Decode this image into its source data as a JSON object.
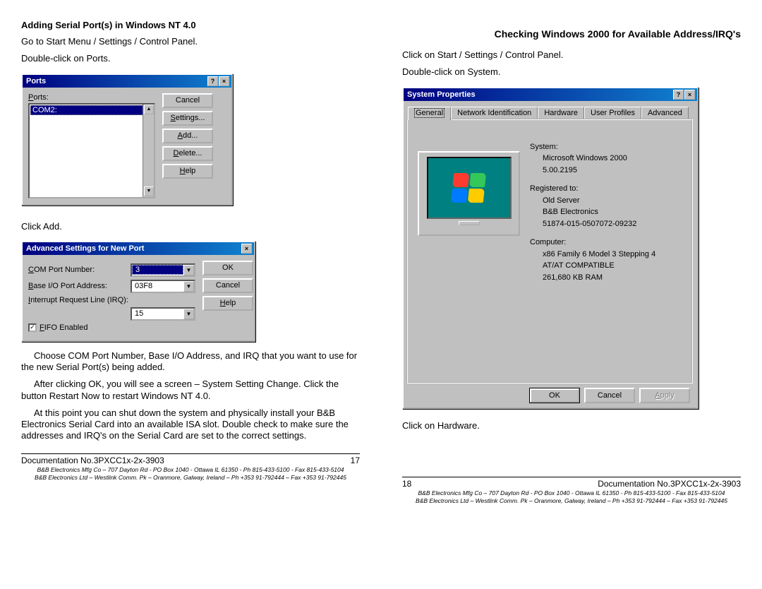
{
  "left": {
    "heading": "Adding Serial Port(s) in Windows NT 4.0",
    "step1": "Go to Start Menu / Settings / Control Panel.",
    "step2": "Double-click on Ports.",
    "step_clickadd": "Click Add.",
    "para1": "Choose COM Port Number, Base I/O Address, and IRQ that you want to use for the new Serial Port(s) being added.",
    "para2": "After clicking OK, you will see a screen – System Setting Change. Click the button Restart Now to restart Windows NT 4.0.",
    "para3": "At this point you can shut down the system and physically install your B&B Electronics Serial Card into an available ISA slot. Double check to make sure the addresses and IRQ's on the Serial Card are set to the correct settings.",
    "ports_window": {
      "title": "Ports",
      "label": "Ports:",
      "selected": "COM2:",
      "btn_cancel": "Cancel",
      "btn_settings": "Settings...",
      "btn_add": "Add...",
      "btn_delete": "Delete...",
      "btn_help": "Help"
    },
    "adv_window": {
      "title": "Advanced Settings for New Port",
      "lbl_com": "COM Port Number:",
      "val_com": "3",
      "lbl_base": "Base I/O Port Address:",
      "val_base": "03F8",
      "lbl_irq": "Interrupt Request Line (IRQ):",
      "val_irq": "15",
      "lbl_fifo": "FIFO Enabled",
      "btn_ok": "OK",
      "btn_cancel": "Cancel",
      "btn_help": "Help"
    },
    "footer": {
      "doc": "Documentation No.3PXCC1x-2x-3903",
      "page": "17",
      "line1": "B&B Electronics Mfg Co – 707 Dayton Rd - PO Box 1040 - Ottawa IL 61350 - Ph 815-433-5100 - Fax 815-433-5104",
      "line2": "B&B Electronics Ltd – Westlink Comm. Pk – Oranmore, Galway, Ireland – Ph +353 91-792444 – Fax +353 91-792445"
    }
  },
  "right": {
    "heading": "Checking Windows 2000 for Available Address/IRQ's",
    "step1": "Click on Start / Settings / Control Panel.",
    "step2": "Double-click on System.",
    "step3": "Click on Hardware.",
    "sys_window": {
      "title": "System Properties",
      "tabs": {
        "general": "General",
        "netid": "Network Identification",
        "hardware": "Hardware",
        "user": "User Profiles",
        "advanced": "Advanced"
      },
      "system_hdr": "System:",
      "system_v1": "Microsoft Windows 2000",
      "system_v2": "5.00.2195",
      "reg_hdr": "Registered to:",
      "reg_v1": "Old Server",
      "reg_v2": "B&B Electronics",
      "reg_v3": "51874-015-0507072-09232",
      "comp_hdr": "Computer:",
      "comp_v1": "x86 Family 6 Model 3 Stepping 4",
      "comp_v2": "AT/AT COMPATIBLE",
      "comp_v3": "261,680 KB RAM",
      "btn_ok": "OK",
      "btn_cancel": "Cancel",
      "btn_apply": "Apply"
    },
    "footer": {
      "page": "18",
      "doc": "Documentation No.3PXCC1x-2x-3903",
      "line1": "B&B Electronics Mfg Co – 707 Dayton Rd - PO Box 1040 - Ottawa IL 61350 - Ph 815-433-5100 - Fax 815-433-5104",
      "line2": "B&B Electronics Ltd – Westlink Comm. Pk – Oranmore, Galway, Ireland – Ph +353 91-792444 – Fax +353 91-792445"
    }
  }
}
